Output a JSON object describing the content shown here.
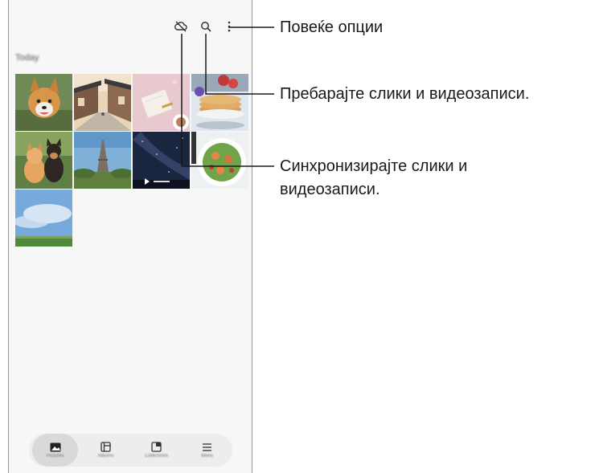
{
  "gallery": {
    "section_label": "Today",
    "tabs": [
      {
        "label": "Pictures",
        "icon": "picture-icon"
      },
      {
        "label": "Albums",
        "icon": "albums-icon"
      },
      {
        "label": "Collections",
        "icon": "collections-icon"
      },
      {
        "label": "Menu",
        "icon": "menu-icon"
      }
    ],
    "toolbar_icons": [
      "cloud-off-icon",
      "search-icon",
      "more-options-icon"
    ]
  },
  "callouts": {
    "more_options": "Повеќе опции",
    "search": "Пребарајте слики и видеозаписи.",
    "sync_line1": "Синхронизирајте слики и",
    "sync_line2": "видеозаписи."
  },
  "colors": {
    "accent_line": "#1a1a1a",
    "phone_bg": "#f7f7f7"
  }
}
